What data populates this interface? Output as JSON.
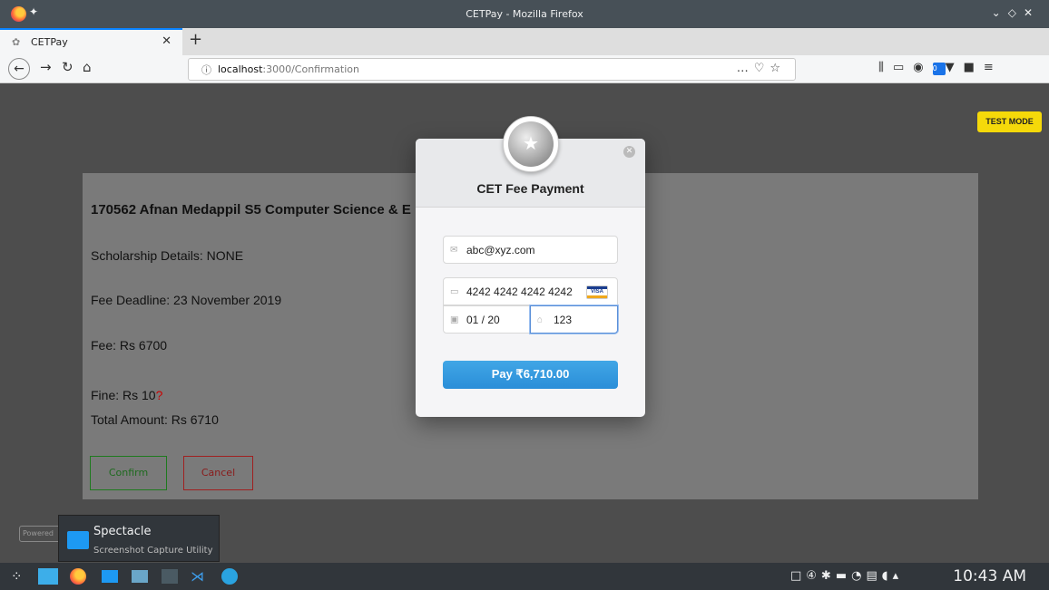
{
  "window": {
    "title": "CETPay - Mozilla Firefox"
  },
  "tabs": [
    {
      "label": "CETPay"
    }
  ],
  "address": {
    "host": "localhost",
    "path": ":3000/Confirmation"
  },
  "student": {
    "name_line": "170562 Afnan Medappil S5 Computer Science & E",
    "scholarship": "Scholarship Details: NONE",
    "deadline": "Fee Deadline: 23 November 2019",
    "fee": "Fee: Rs 6700",
    "fine": "Fine: Rs 10",
    "fine_mark": "?",
    "total": "Total Amount: Rs 6710",
    "confirm_label": "Confirm",
    "cancel_label": "Cancel"
  },
  "test_mode": "TEST MODE",
  "powered": "Powered",
  "checkout": {
    "title": "CET Fee Payment",
    "email": "abc@xyz.com",
    "card_number": "4242 4242 4242 4242",
    "card_brand": "VISA",
    "expiry": "01 / 20",
    "cvc": "123",
    "pay_label": "Pay ₹6,710.00"
  },
  "tooltip": {
    "name": "Spectacle",
    "description": "Screenshot Capture Utility"
  },
  "taskbar": {
    "clock": "10:43 AM"
  },
  "colors": {
    "accent": "#0a84ff",
    "pay": "#2a8ed8",
    "test_mode": "#f5d90a",
    "confirm": "#1e7a1e",
    "cancel": "#a02020"
  },
  "icons": [
    "firefox-icon",
    "pin-icon",
    "close-tab-icon",
    "new-tab-icon",
    "back-icon",
    "forward-icon",
    "reload-icon",
    "home-icon",
    "info-icon",
    "more-icon",
    "pocket-icon",
    "bookmark-star-icon",
    "library-icon",
    "sidebar-icon",
    "account-icon",
    "mail-icon",
    "card-icon",
    "calendar-icon",
    "lock-icon"
  ]
}
